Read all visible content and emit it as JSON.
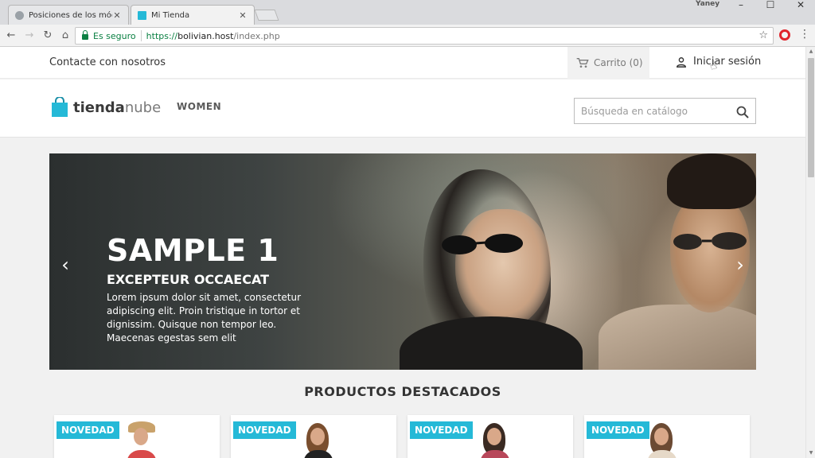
{
  "browser": {
    "tabs": [
      {
        "title": "Posiciones de los módul",
        "active": false
      },
      {
        "title": "Mi Tienda",
        "active": true
      }
    ],
    "window_user": "Yaney",
    "security_label": "Es seguro",
    "url": {
      "protocol": "https://",
      "host": "bolivian.host",
      "path": "/index.php"
    }
  },
  "topnav": {
    "contact": "Contacte con nosotros",
    "cart": "Carrito (0)",
    "signin": "Iniciar sesión"
  },
  "header": {
    "logo_bold": "tienda",
    "logo_light": "nube",
    "menu_item": "WOMEN",
    "search_placeholder": "Búsqueda en catálogo"
  },
  "hero": {
    "title": "SAMPLE 1",
    "subtitle": "EXCEPTEUR OCCAECAT",
    "description": "Lorem ipsum dolor sit amet, consectetur adipiscing elit. Proin tristique in tortor et dignissim. Quisque non tempor leo. Maecenas egestas sem elit"
  },
  "featured": {
    "title": "PRODUCTOS DESTACADOS",
    "products": [
      {
        "badge": "NOVEDAD"
      },
      {
        "badge": "NOVEDAD"
      },
      {
        "badge": "NOVEDAD"
      },
      {
        "badge": "NOVEDAD"
      }
    ]
  },
  "colors": {
    "accent": "#25b9d7",
    "secure": "#0b8043"
  }
}
